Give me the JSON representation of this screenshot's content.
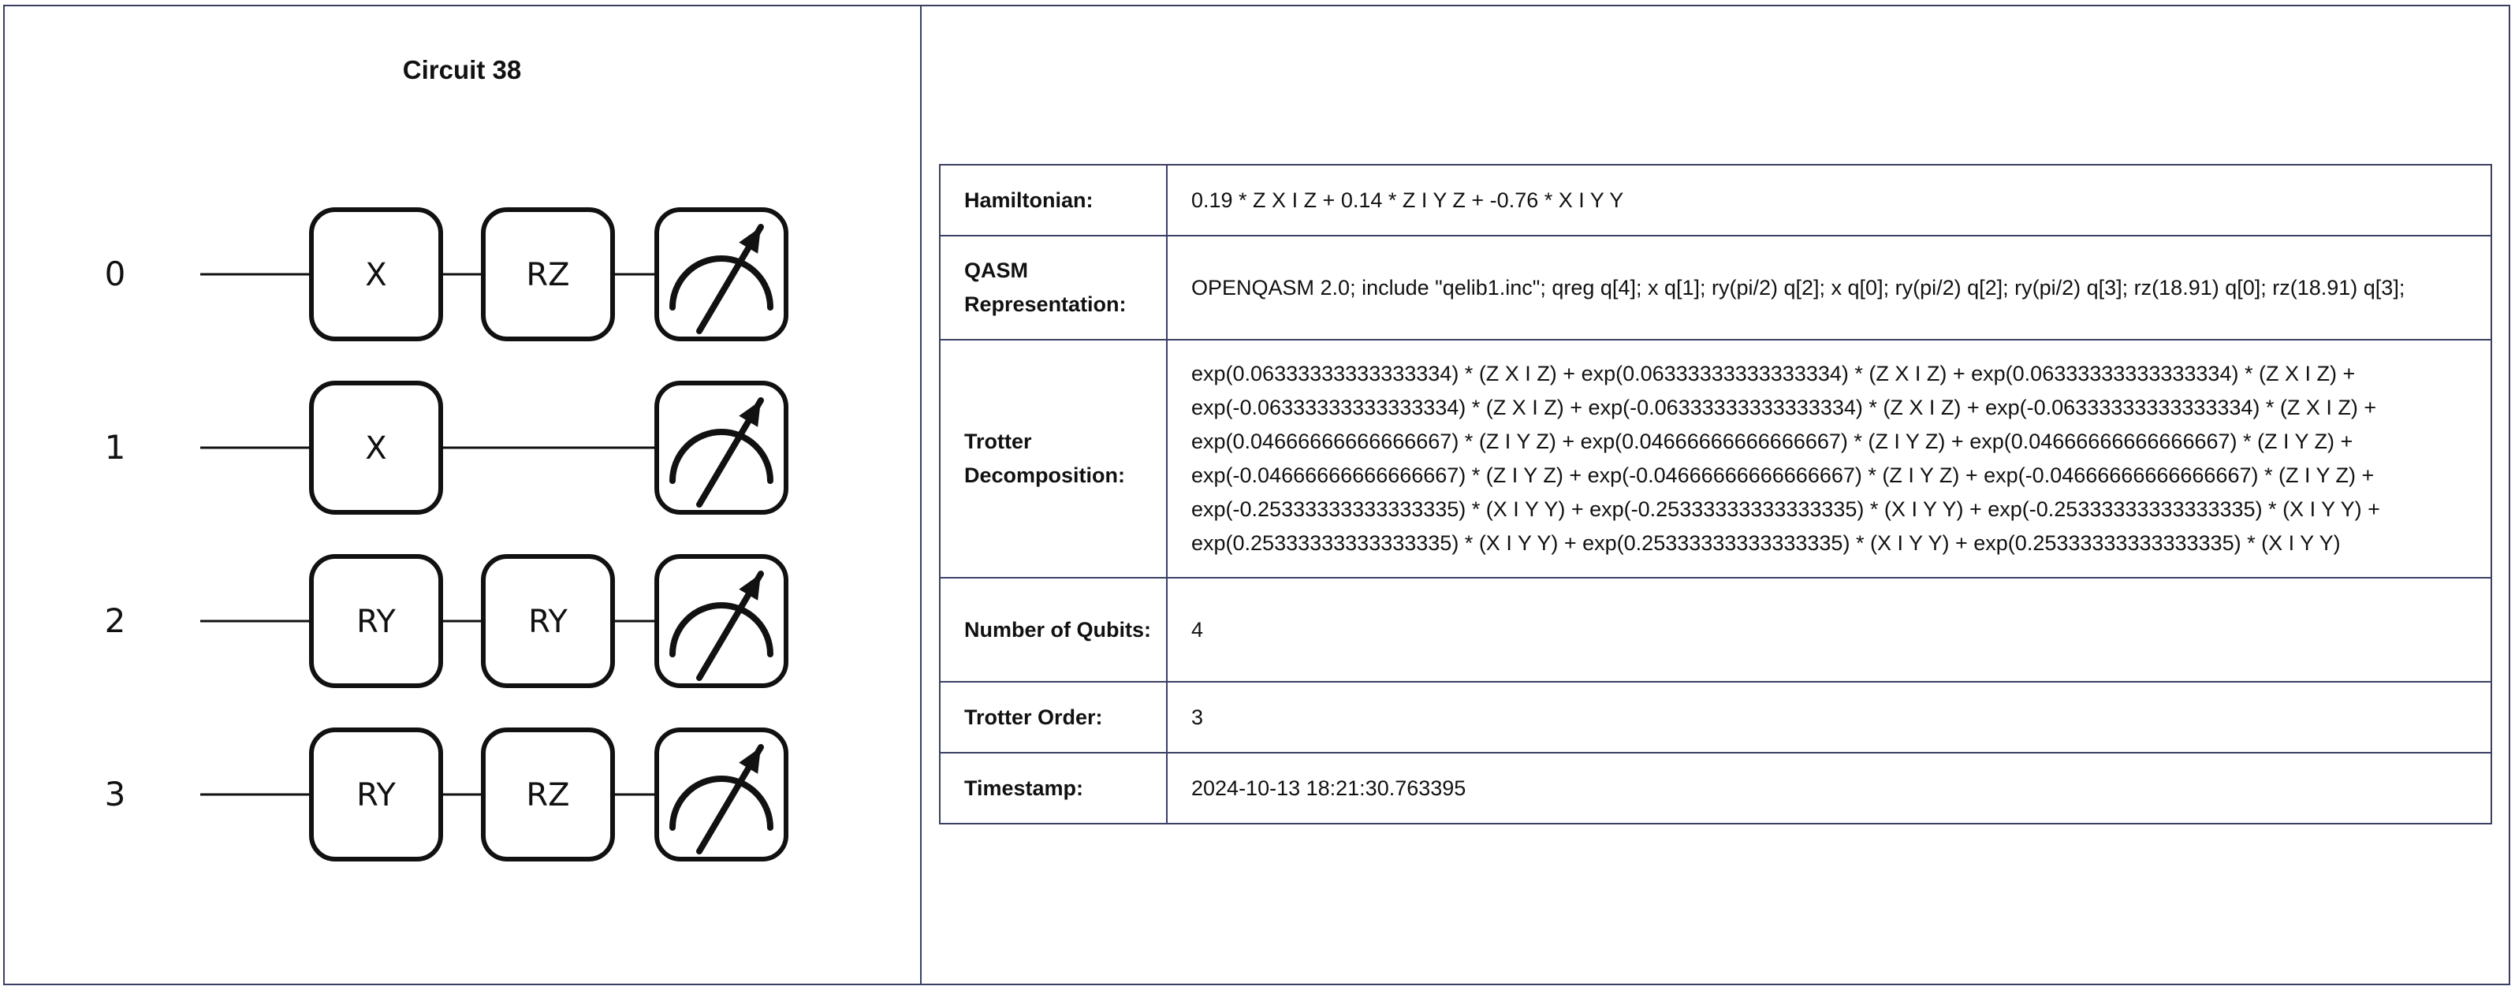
{
  "circuit": {
    "title": "Circuit 38",
    "wires": [
      {
        "label": "0",
        "gates": [
          "X",
          "RZ"
        ],
        "measured": true
      },
      {
        "label": "1",
        "gates": [
          "X"
        ],
        "measured": true
      },
      {
        "label": "2",
        "gates": [
          "RY",
          "RY"
        ],
        "measured": true
      },
      {
        "label": "3",
        "gates": [
          "RY",
          "RZ"
        ],
        "measured": true
      }
    ]
  },
  "table": {
    "hamiltonian_label": "Hamiltonian:",
    "hamiltonian_value": "0.19 * Z X I Z + 0.14 * Z I Y Z + -0.76 * X I Y Y",
    "qasm_label": "QASM Representation:",
    "qasm_value": "OPENQASM 2.0; include \"qelib1.inc\"; qreg q[4]; x q[1]; ry(pi/2) q[2]; x q[0]; ry(pi/2) q[2]; ry(pi/2) q[3]; rz(18.91) q[0]; rz(18.91) q[3];",
    "trotter_label": "Trotter Decomposition:",
    "trotter_value": "exp(0.06333333333333334) * (Z X I Z) + exp(0.06333333333333334) * (Z X I Z) + exp(0.06333333333333334) * (Z X I Z) + exp(-0.06333333333333334) * (Z X I Z) + exp(-0.06333333333333334) * (Z X I Z) + exp(-0.06333333333333334) * (Z X I Z) + exp(0.04666666666666667) * (Z I Y Z) + exp(0.04666666666666667) * (Z I Y Z) + exp(0.04666666666666667) * (Z I Y Z) + exp(-0.04666666666666667) * (Z I Y Z) + exp(-0.04666666666666667) * (Z I Y Z) + exp(-0.04666666666666667) * (Z I Y Z) + exp(-0.25333333333333335) * (X I Y Y) + exp(-0.25333333333333335) * (X I Y Y) + exp(-0.25333333333333335) * (X I Y Y) + exp(0.25333333333333335) * (X I Y Y) + exp(0.25333333333333335) * (X I Y Y) + exp(0.25333333333333335) * (X I Y Y)",
    "qubits_label": "Number of Qubits:",
    "qubits_value": "4",
    "order_label": "Trotter Order:",
    "order_value": "3",
    "timestamp_label": "Timestamp:",
    "timestamp_value": "2024-10-13 18:21:30.763395"
  }
}
